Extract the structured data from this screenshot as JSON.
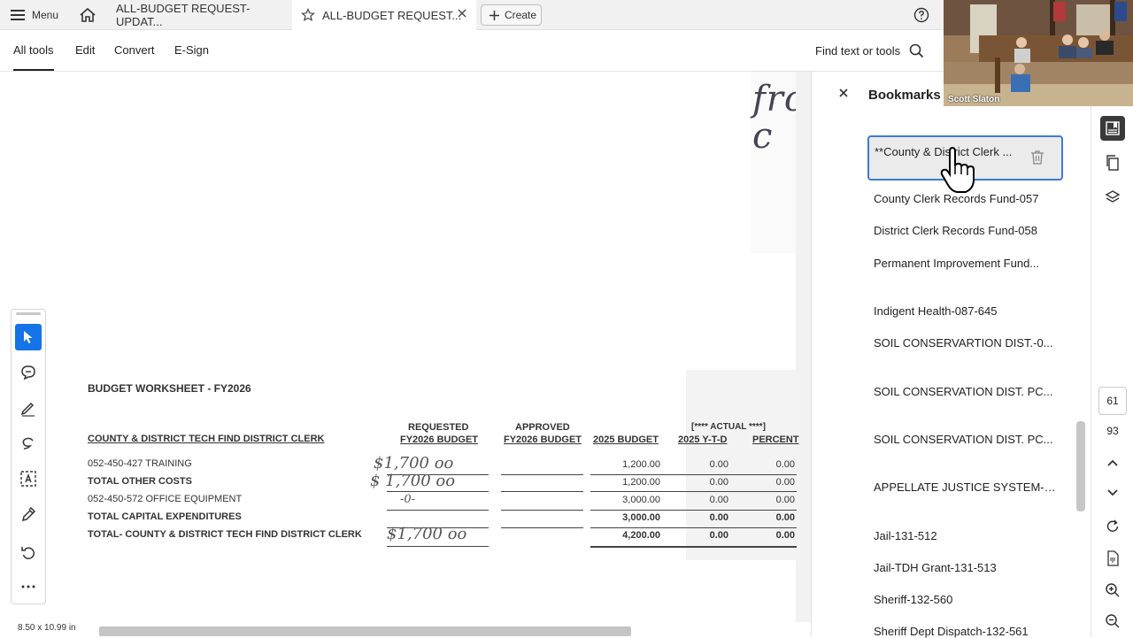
{
  "topbar": {
    "menu_label": "Menu",
    "tabs": [
      {
        "title": "ALL-BUDGET REQUEST-UPDAT..."
      },
      {
        "title": "ALL-BUDGET REQUEST..."
      }
    ],
    "create_label": "Create"
  },
  "toolbar": {
    "tabs": [
      "All tools",
      "Edit",
      "Convert",
      "E-Sign"
    ],
    "find_label": "Find text or tools"
  },
  "document": {
    "top_handwriting": "fro\nc",
    "worksheet_title": "BUDGET WORKSHEET - FY2026",
    "headers": {
      "dept": "COUNTY & DISTRICT TECH FIND DISTRICT CLERK",
      "requested_1": "REQUESTED",
      "requested_2": "FY2026 BUDGET",
      "approved_1": "APPROVED",
      "approved_2": "FY2026 BUDGET",
      "budget_2025": "2025 BUDGET",
      "actual": "[**** ACTUAL ****]",
      "ytd": "2025 Y-T-D",
      "percent": "PERCENT"
    },
    "rows": [
      {
        "label": "052-450-427 TRAINING",
        "requested": "$1,700 oo",
        "budget": "1,200.00",
        "ytd": "0.00",
        "pct": "0.00",
        "bold": false
      },
      {
        "label": "TOTAL OTHER COSTS",
        "requested": "$ 1,700 oo",
        "budget": "1,200.00",
        "ytd": "0.00",
        "pct": "0.00",
        "bold": false
      },
      {
        "label": "052-450-572 OFFICE EQUIPMENT",
        "requested": "-0-",
        "budget": "3,000.00",
        "ytd": "0.00",
        "pct": "0.00",
        "bold": false
      },
      {
        "label": "TOTAL CAPITAL EXPENDITURES",
        "requested": "",
        "budget": "3,000.00",
        "ytd": "0.00",
        "pct": "0.00",
        "bold": true
      },
      {
        "label": "TOTAL- COUNTY & DISTRICT TECH FIND DISTRICT CLERK",
        "requested": "$1,700 oo",
        "budget": "4,200.00",
        "ytd": "0.00",
        "pct": "0.00",
        "bold": true
      }
    ],
    "page_size": "8.50 x 10.99 in"
  },
  "bookmarks": {
    "title": "Bookmarks",
    "selected": "**County & District Clerk ...",
    "items": [
      "County Clerk Records Fund-057",
      "District Clerk Records Fund-058",
      "Permanent Improvement Fund...",
      "Indigent Health-087-645",
      "SOIL CONSERVARTION DIST.-0...",
      "SOIL CONSERVATION DIST. PC...",
      "SOIL CONSERVATION DIST. PC...",
      "APPELLATE JUSTICE SYSTEM-0...",
      "Jail-131-512",
      "Jail-TDH Grant-131-513",
      "Sheriff-132-560",
      "Sheriff Dept Dispatch-132-561"
    ]
  },
  "rail": {
    "current_page": "61",
    "total_pages": "93"
  },
  "video": {
    "participant": "Scott Slaton"
  },
  "colors": {
    "accent": "#1473e6",
    "selected_border": "#3d7bd4"
  }
}
